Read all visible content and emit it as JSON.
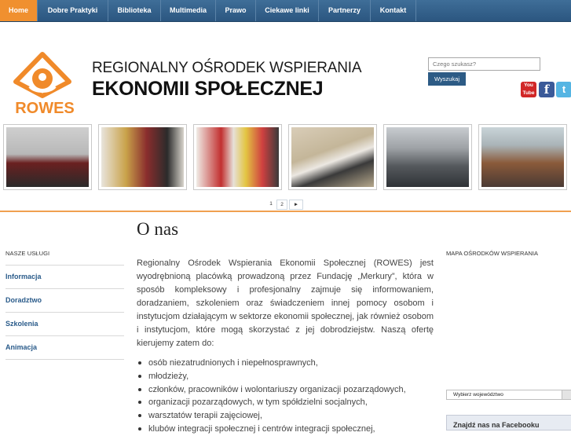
{
  "nav": {
    "items": [
      {
        "label": "Home",
        "active": true
      },
      {
        "label": "Dobre Praktyki",
        "active": false
      },
      {
        "label": "Biblioteka",
        "active": false
      },
      {
        "label": "Multimedia",
        "active": false
      },
      {
        "label": "Prawo",
        "active": false
      },
      {
        "label": "Ciekawe linki",
        "active": false
      },
      {
        "label": "Partnerzy",
        "active": false
      },
      {
        "label": "Kontakt",
        "active": false
      }
    ]
  },
  "brand": {
    "logo_text": "ROWES",
    "line1": "REGIONALNY OŚRODEK WSPIERANIA",
    "line2": "EKONOMII SPOŁECZNEJ"
  },
  "search": {
    "placeholder": "Czego szukasz?",
    "button_label": "Wyszukaj"
  },
  "social": {
    "youtube_label": "You Tube",
    "facebook_label": "f",
    "twitter_label": "t"
  },
  "gallery": {
    "thumb_count": 6,
    "pages": [
      "1",
      "2"
    ],
    "next_label": "►"
  },
  "sidebar": {
    "title": "NASZE USŁUGI",
    "items": [
      "Informacja",
      "Doradztwo",
      "Szkolenia",
      "Animacja"
    ]
  },
  "main": {
    "title": "O nas",
    "paragraph": "Regionalny Ośrodek Wspierania Ekonomii Społecznej (ROWES) jest wyodrębnioną placówką prowadzoną przez Fundację „Merkury”, która w sposób kompleksowy i profesjonalny zajmuje się informowaniem, doradzaniem, szkoleniem oraz świadczeniem innej pomocy osobom i instytucjom działającym w sektorze ekonomii społecznej, jak również osobom i instytucjom, które mogą skorzystać z jej dobrodziejstw. Naszą ofertę kierujemy zatem do:",
    "list": [
      "osób niezatrudnionych i niepełnosprawnych,",
      "młodzieży,",
      "członków, pracowników i wolontariuszy organizacji pozarządowych,",
      "organizacji pozarządowych, w tym spółdzielni socjalnych,",
      "warsztatów terapii zajęciowej,",
      "klubów integracji społecznej i centrów integracji społecznej,"
    ]
  },
  "right": {
    "map_title": "MAPA OŚRODKÓW WSPIERANIA",
    "select_label": "Wybierz województwo",
    "facebook_box": "Znajdź nas na Facebooku"
  },
  "colors": {
    "nav_bg": "#2b5680",
    "accent_orange": "#f0902f",
    "link_blue": "#2a5b8a"
  }
}
